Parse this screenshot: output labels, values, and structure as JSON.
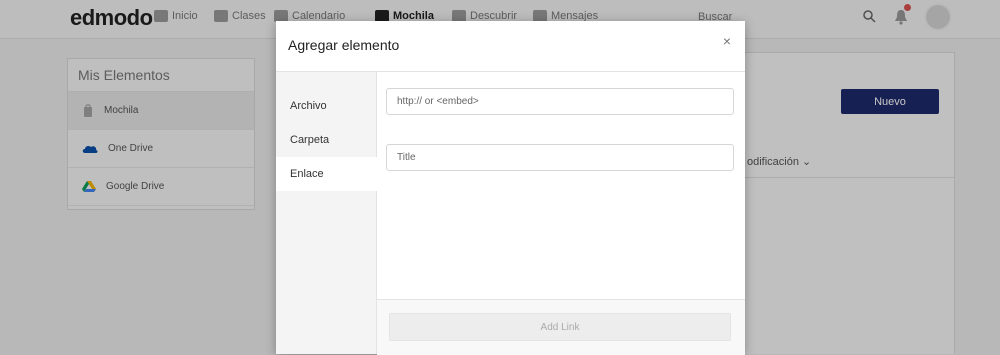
{
  "app": {
    "logo": "edmodo",
    "nav": [
      {
        "label": "Inicio",
        "icon": "home-icon"
      },
      {
        "label": "Clases",
        "icon": "classes-icon"
      },
      {
        "label": "Calendario",
        "icon": "calendar-icon"
      },
      {
        "label": "Mochila",
        "icon": "backpack-icon",
        "active": true
      },
      {
        "label": "Descubrir",
        "icon": "discover-icon"
      },
      {
        "label": "Mensajes",
        "icon": "messages-icon"
      }
    ],
    "search_label": "Buscar"
  },
  "sidebar": {
    "title": "Mis Elementos",
    "items": [
      {
        "label": "Mochila",
        "icon": "backpack-icon"
      },
      {
        "label": "One Drive",
        "icon": "onedrive-icon"
      },
      {
        "label": "Google Drive",
        "icon": "google-drive-icon"
      }
    ]
  },
  "main": {
    "new_button": "Nuevo",
    "sort_label": "odificación ⌄"
  },
  "modal": {
    "title": "Agregar elemento",
    "close": "×",
    "tabs": [
      {
        "label": "Archivo"
      },
      {
        "label": "Carpeta"
      },
      {
        "label": "Enlace",
        "active": true
      }
    ],
    "url_placeholder": "http:// or <embed>",
    "title_placeholder": "Title",
    "submit": "Add Link"
  },
  "colors": {
    "accent": "#1e2a6b",
    "overlay": "rgba(0,0,0,0.22)"
  }
}
